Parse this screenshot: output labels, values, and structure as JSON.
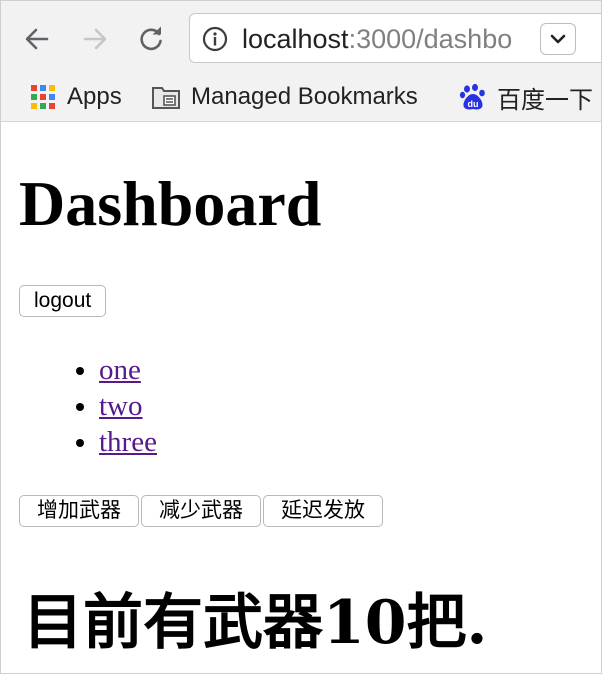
{
  "browser": {
    "url": {
      "host": "localhost",
      "rest": ":3000/dashbo"
    },
    "nav_icons": [
      "back-arrow-icon",
      "forward-arrow-icon",
      "reload-icon",
      "info-icon"
    ],
    "bookmarks": [
      {
        "label": "Apps",
        "icon": "apps-grid-icon"
      },
      {
        "label": "Managed Bookmarks",
        "icon": "folder-icon"
      },
      {
        "label": "百度一下",
        "icon": "baidu-paw-icon"
      }
    ]
  },
  "page": {
    "title": "Dashboard",
    "logout_label": "logout",
    "links": [
      "one",
      "two",
      "three"
    ],
    "actions": [
      "增加武器",
      "减少武器",
      "延迟发放"
    ],
    "count_text": "目前有武器10把."
  },
  "colors": {
    "link": "#551a8b",
    "toolbar_bg": "#f2f2f2",
    "baidu_blue": "#2932e1"
  }
}
